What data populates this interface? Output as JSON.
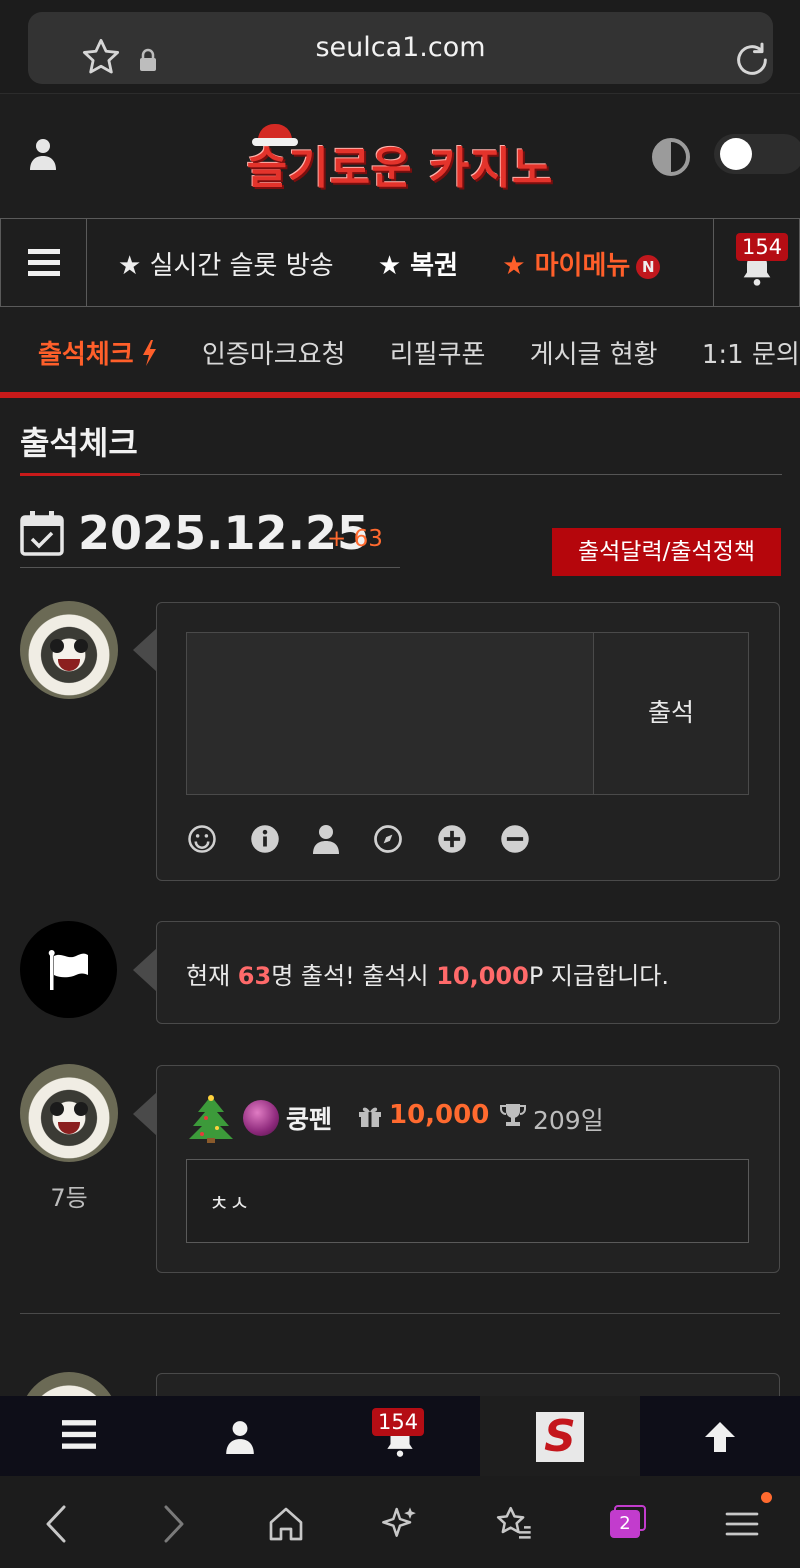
{
  "browser": {
    "url": "seulca1.com",
    "tab_count": "2"
  },
  "header": {
    "logo_text": "슬기로운 카지노"
  },
  "nav": {
    "items": [
      "★ 실시간 슬롯 방송",
      "★ 복권",
      "★ 마이메뉴"
    ],
    "new_badge": "N",
    "bell_count": "154"
  },
  "subtabs": [
    "출석체크",
    "인증마크요청",
    "리필쿠폰",
    "게시글 현황",
    "1:1 문의"
  ],
  "page": {
    "title": "출석체크",
    "date": "2025.12.25",
    "date_plus": "+ 63",
    "policy_button": "출석달력/출석정책"
  },
  "compose": {
    "submit_label": "출석"
  },
  "notice": {
    "prefix": "현재 ",
    "count": "63",
    "middle": "명 출석! 출석시 ",
    "points": "10,000",
    "suffix": "P 지급합니다."
  },
  "entry": {
    "rank": "7등",
    "nickname": "쿵펜",
    "points": "10,000",
    "days": "209일",
    "comment": "ㅊㅅ"
  },
  "bottom_bar": {
    "bell_count": "154",
    "logo_letter": "S"
  },
  "colors": {
    "accent": "#ff6a2f",
    "brand_red": "#c81a1a",
    "highlight": "#ff6a6a"
  }
}
